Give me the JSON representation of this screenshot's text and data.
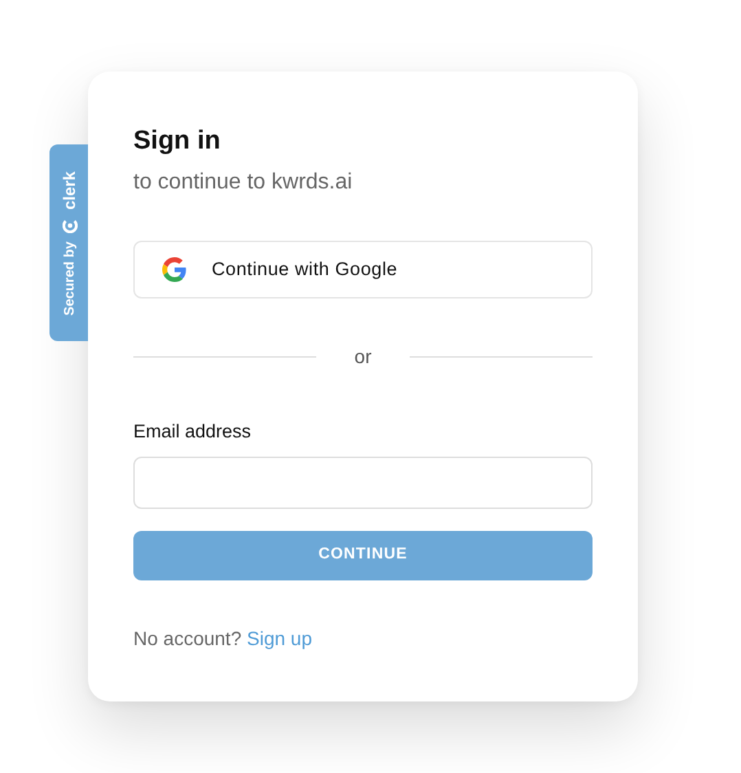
{
  "badge": {
    "label": "Secured by",
    "brand": "clerk"
  },
  "card": {
    "title": "Sign in",
    "subtitle": "to continue to kwrds.ai"
  },
  "social_button": {
    "label": "Continue with Google"
  },
  "divider": {
    "label": "or"
  },
  "email": {
    "label": "Email address"
  },
  "submit": {
    "label": "CONTINUE",
    "disabled": true
  },
  "footer": {
    "text": "No account?",
    "link": "Sign up"
  }
}
